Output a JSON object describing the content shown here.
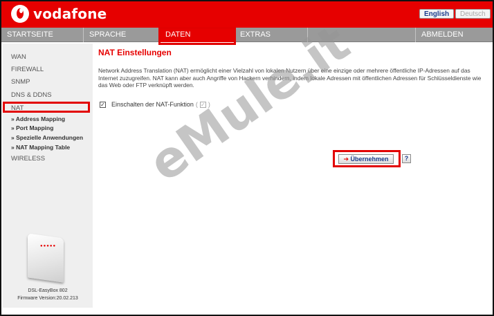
{
  "header": {
    "brand": "vodafone",
    "lang_english": "English",
    "lang_deutsch": "Deutsch"
  },
  "nav": {
    "items": [
      "STARTSEITE",
      "SPRACHE",
      "DATEN",
      "EXTRAS",
      "ABMELDEN"
    ],
    "active": "DATEN"
  },
  "sidebar": {
    "items": [
      "WAN",
      "FIREWALL",
      "SNMP",
      "DNS & DDNS",
      "NAT"
    ],
    "sub_items": [
      "» Address Mapping",
      "» Port Mapping",
      "» Spezielle Anwendungen",
      "» NAT Mapping Table"
    ],
    "wireless": "WIRELESS",
    "device_name": "DSL-EasyBox 802",
    "firmware": "Firmware Version:20.02.213"
  },
  "main": {
    "title": "NAT Einstellungen",
    "description": "Network Address Translation (NAT) ermöglicht einer Vielzahl von lokalen Nutzern über eine einzige oder mehrere öffentliche IP-Adressen auf das Internet zuzugreifen. NAT kann aber auch Angriffe von Hackern verhindern, indem lokale Adressen mit öffentlichen Adressen für Schlüsseldienste wie das Web oder FTP verknüpft werden.",
    "nat_checkbox_label": "Einschalten der NAT-Funktion",
    "nat_checkbox_checked": true,
    "apply_label": "Übernehmen",
    "help_label": "?"
  },
  "watermark": "eMule.it",
  "colors": {
    "brand_red": "#e60000",
    "nav_gray": "#9a9a9a",
    "highlight": "#e20000"
  }
}
